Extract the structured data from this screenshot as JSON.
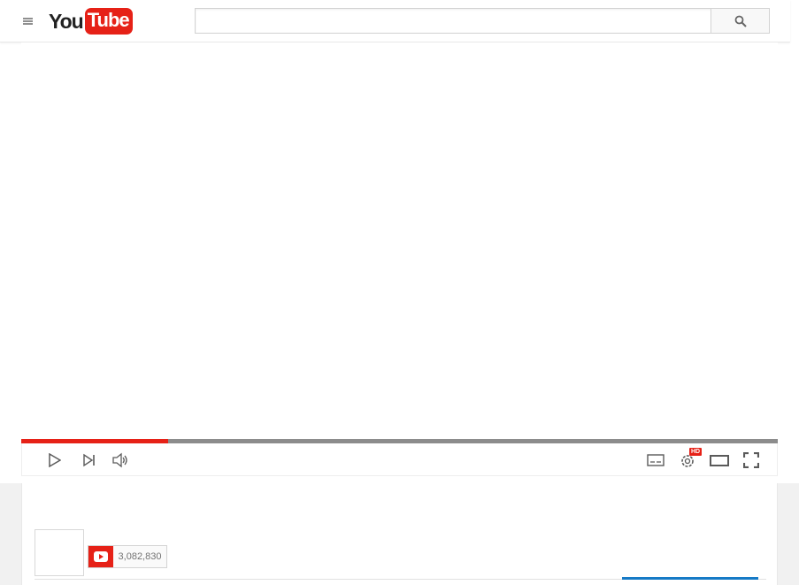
{
  "header": {
    "menu_icon": "hamburger-menu-icon",
    "logo": {
      "you": "You",
      "tube": "Tube"
    },
    "search": {
      "value": "",
      "placeholder": ""
    },
    "search_button_icon": "search-icon"
  },
  "player": {
    "progress_fraction": 0.194,
    "colors": {
      "played": "#e62117",
      "track": "#8c8c8c"
    },
    "controls": {
      "left": [
        "play-icon",
        "next-icon",
        "volume-icon"
      ],
      "right": [
        "subtitles-icon",
        "settings-icon",
        "theater-mode-icon",
        "fullscreen-icon"
      ],
      "hd_badge": "HD"
    }
  },
  "channel": {
    "subscriber_count": "3,082,830",
    "subscribe_icon": "youtube-play-icon"
  }
}
